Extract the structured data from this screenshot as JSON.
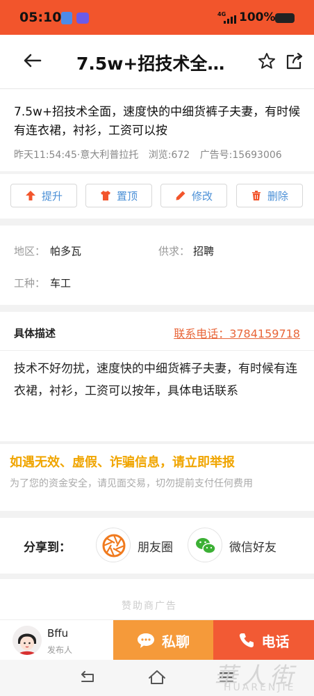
{
  "status_bar": {
    "time": "05:10",
    "network": "4G",
    "battery": "100%"
  },
  "header": {
    "title": "7.5w+招技术全…"
  },
  "post": {
    "title": "7.5w+招技术全面，速度快的中细货裤子夫妻，有时候有连衣裙，衬衫，工资可以按",
    "posted": "昨天11:54:45·意大利普拉托",
    "views": "浏览:672",
    "ad_no": "广告号:15693006"
  },
  "actions": [
    {
      "label": "提升",
      "icon": "arrow-up-icon",
      "color": "#f2552c"
    },
    {
      "label": "置顶",
      "icon": "shirt-icon",
      "color": "#f2552c"
    },
    {
      "label": "修改",
      "icon": "pencil-icon",
      "color": "#f2552c"
    },
    {
      "label": "删除",
      "icon": "trash-icon",
      "color": "#f2552c"
    }
  ],
  "info": {
    "region_label": "地区：",
    "region": "帕多瓦",
    "supply_label": "供求：",
    "supply": "招聘",
    "job_label": "工种：",
    "job": "车工"
  },
  "description": {
    "heading": "具体描述",
    "phone": "联系电话：3784159718",
    "body": "技术不好勿扰，速度快的中细货裤子夫妻，有时候有连衣裙，衬衫，工资可以按年，具体电话联系"
  },
  "warning": {
    "title": "如遇无效、虚假、诈骗信息，请立即举报",
    "note": "为了您的资金安全，请见面交易，切勿提前支付任何费用"
  },
  "share": {
    "label": "分享到：",
    "moments": "朋友圈",
    "wechat": "微信好友"
  },
  "sponsor": {
    "text": "赞助商广告"
  },
  "bottom": {
    "user": "Bffu",
    "role": "发布人",
    "chat": "私聊",
    "call": "电话"
  },
  "watermark": {
    "cn": "華人街",
    "en": "HUARENJIE"
  },
  "colors": {
    "brand": "#f2552c",
    "chat": "#f59a3a",
    "warning": "#f0a500",
    "link": "#4a8fd6"
  }
}
